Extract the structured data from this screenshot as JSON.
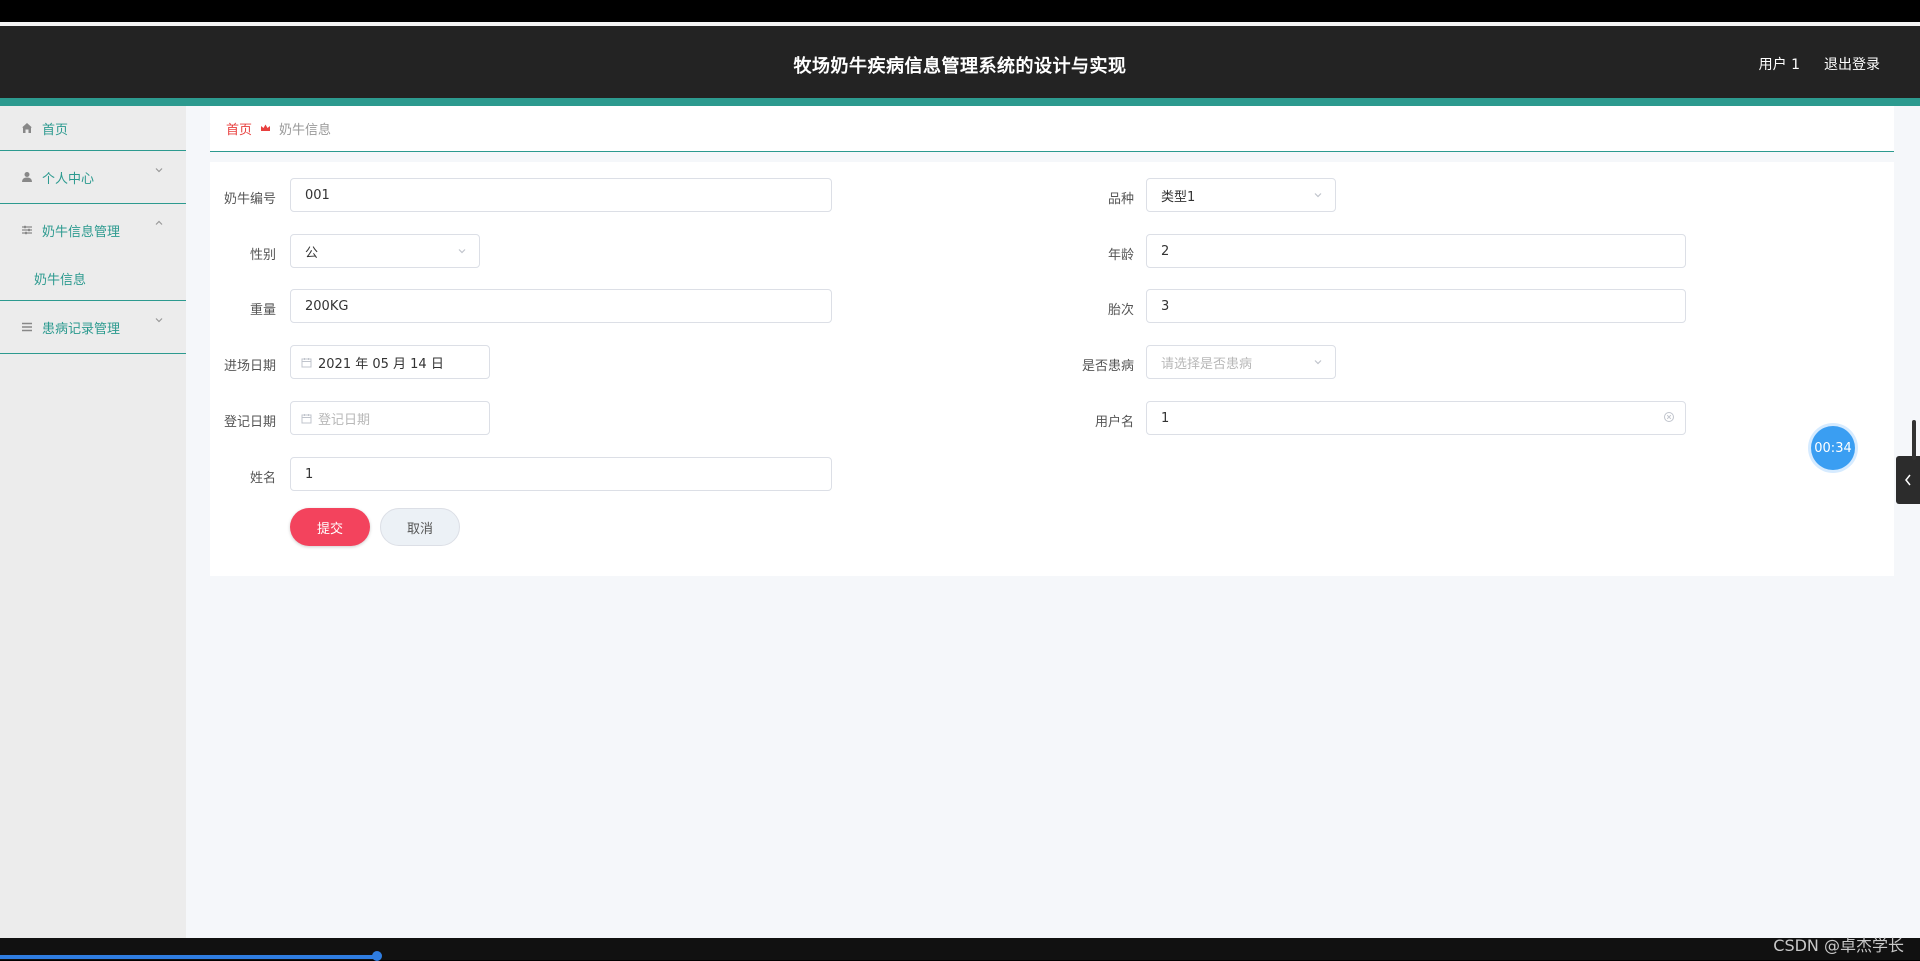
{
  "header": {
    "title": "牧场奶牛疾病信息管理系统的设计与实现",
    "user": "用户 1",
    "logout": "退出登录"
  },
  "sidebar": {
    "items": [
      {
        "label": "首页",
        "icon": "home-icon"
      },
      {
        "label": "个人中心",
        "icon": "user-icon",
        "expanded": false
      },
      {
        "label": "奶牛信息管理",
        "icon": "sliders-icon",
        "expanded": true,
        "children": [
          {
            "label": "奶牛信息"
          }
        ]
      },
      {
        "label": "患病记录管理",
        "icon": "list-icon",
        "expanded": false
      }
    ]
  },
  "breadcrumb": {
    "home": "首页",
    "current": "奶牛信息"
  },
  "form": {
    "cow_id": {
      "label": "奶牛编号",
      "value": "001"
    },
    "breed": {
      "label": "品种",
      "value": "类型1"
    },
    "gender": {
      "label": "性别",
      "value": "公"
    },
    "age": {
      "label": "年龄",
      "value": "2"
    },
    "weight": {
      "label": "重量",
      "value": "200KG"
    },
    "parity": {
      "label": "胎次",
      "value": "3"
    },
    "entry_date": {
      "label": "进场日期",
      "value": "2021 年 05 月 14 日"
    },
    "is_sick": {
      "label": "是否患病",
      "placeholder": "请选择是否患病"
    },
    "register_date": {
      "label": "登记日期",
      "placeholder": "登记日期"
    },
    "username": {
      "label": "用户名",
      "value": "1"
    },
    "name": {
      "label": "姓名",
      "value": "1"
    },
    "submit": "提交",
    "cancel": "取消"
  },
  "overlay": {
    "timer": "00:34",
    "watermark": "CSDN @卓杰学长"
  },
  "colors": {
    "accent": "#2c9a8f",
    "submit": "#f3435d",
    "header_bg": "#232323"
  }
}
